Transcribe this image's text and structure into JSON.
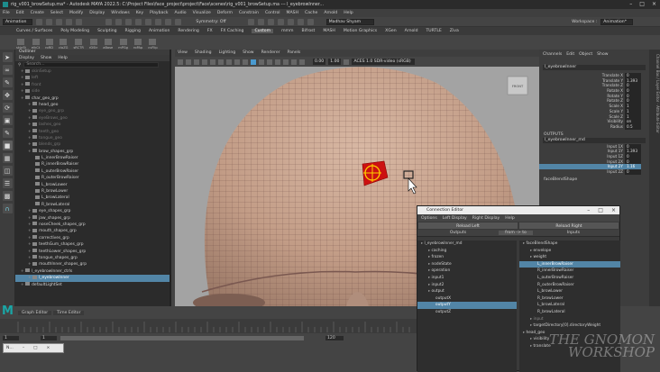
{
  "window": {
    "title": "rig_v001_browSetup.ma* - Autodesk MAYA 2022.5: C:\\Project Files\\face_project\\project\\Face\\scenes\\rig_v001_browSetup.ma  ---  l_eyebrowInner..."
  },
  "menubar": [
    "File",
    "Edit",
    "Create",
    "Select",
    "Modify",
    "Display",
    "Windows",
    "Key",
    "Playback",
    "Audio",
    "Visualize",
    "Deform",
    "Constrain",
    "Control",
    "MASH",
    "Cache",
    "Arnold",
    "Help"
  ],
  "menubar_right": [
    "ZBrush",
    "Cache",
    "AdvSkin",
    "FX",
    "Zeo Tools",
    "Ziva Transfer",
    "Arnold",
    "Help"
  ],
  "statusline": {
    "mode": "Animation",
    "symmetry": "Symmetry: Off",
    "user": "Madhav Shyam",
    "workspace_label": "Workspace :",
    "workspace": "Animation*"
  },
  "shelf_tabs": [
    "Curves / Surfaces",
    "Poly Modeling",
    "Sculpting",
    "Rigging",
    "Animation",
    "Rendering",
    "FX",
    "FX Caching",
    "Custom",
    "mmm",
    "Bifrost",
    "MASH",
    "Motion Graphics",
    "XGen",
    "Arnold",
    "TURTLE",
    "Ziva"
  ],
  "shelf_active": "Custom",
  "shelf_buttons": [
    "skinSt",
    "elkCt",
    "roRD",
    "cloZG",
    "sRCTR",
    "rDStr",
    "aBase",
    "mPGg",
    "roPAp",
    "cvFlip"
  ],
  "outliner": {
    "title": "Outliner",
    "menu": [
      "Display",
      "Show",
      "Help"
    ],
    "search_placeholder": "Search...",
    "rows": [
      {
        "label": "skinSetup",
        "indent": 0,
        "dim": true
      },
      {
        "label": "left",
        "indent": 0,
        "dim": true
      },
      {
        "label": "front",
        "indent": 0,
        "dim": true
      },
      {
        "label": "side",
        "indent": 0,
        "dim": true
      },
      {
        "label": "char_geo_grp",
        "indent": 0,
        "dim": false
      },
      {
        "label": "head_geo",
        "indent": 1,
        "dim": false
      },
      {
        "label": "eye_geo_grp",
        "indent": 1,
        "dim": true
      },
      {
        "label": "eyeBrows_geo",
        "indent": 1,
        "dim": true
      },
      {
        "label": "lashes_geo",
        "indent": 1,
        "dim": true
      },
      {
        "label": "teeth_geo",
        "indent": 1,
        "dim": true
      },
      {
        "label": "tongue_geo",
        "indent": 1,
        "dim": true
      },
      {
        "label": "blends_grp",
        "indent": 1,
        "dim": true
      },
      {
        "label": "brow_shapes_grp",
        "indent": 1,
        "dim": false
      },
      {
        "label": "L_innerBrowRaiser",
        "indent": 2,
        "dim": false
      },
      {
        "label": "R_innerBrowRaiser",
        "indent": 2,
        "dim": false
      },
      {
        "label": "L_outerBrowRaiser",
        "indent": 2,
        "dim": false
      },
      {
        "label": "R_outerBrowRaiser",
        "indent": 2,
        "dim": false
      },
      {
        "label": "L_browLower",
        "indent": 2,
        "dim": false
      },
      {
        "label": "R_browLower",
        "indent": 2,
        "dim": false
      },
      {
        "label": "L_browLateral",
        "indent": 2,
        "dim": false
      },
      {
        "label": "R_browLateral",
        "indent": 2,
        "dim": false
      },
      {
        "label": "eye_shapes_grp",
        "indent": 1,
        "dim": false
      },
      {
        "label": "jaw_shapes_grp",
        "indent": 1,
        "dim": false
      },
      {
        "label": "noseCheek_shapes_grp",
        "indent": 1,
        "dim": false
      },
      {
        "label": "mouth_shapes_grp",
        "indent": 1,
        "dim": false
      },
      {
        "label": "correctives_grp",
        "indent": 1,
        "dim": false
      },
      {
        "label": "teethGum_shapes_grp",
        "indent": 1,
        "dim": false
      },
      {
        "label": "teethLower_shapes_grp",
        "indent": 1,
        "dim": false
      },
      {
        "label": "tongue_shapes_grp",
        "indent": 1,
        "dim": false
      },
      {
        "label": "mouthInner_shapes_grp",
        "indent": 1,
        "dim": false
      },
      {
        "label": "l_eyebrowInner_ctrls",
        "indent": 0,
        "dim": false
      },
      {
        "label": "l_eyebrowInner",
        "indent": 1,
        "dim": false,
        "selected": true
      },
      {
        "label": "defaultLightSet",
        "indent": 0,
        "dim": false
      }
    ]
  },
  "viewport": {
    "menu": [
      "View",
      "Shading",
      "Lighting",
      "Show",
      "Renderer",
      "Panels"
    ],
    "near_clip": "0.00",
    "far_clip": "1.00",
    "colorspace": "ACES 1.0 SDR-video (sRGB)",
    "camera_label": "FRONT"
  },
  "channel_box": {
    "tabs": [
      "Channels",
      "Edit",
      "Object",
      "Show"
    ],
    "object": "l_eyebrowInner",
    "attrs": [
      {
        "name": "Translate X",
        "value": "0"
      },
      {
        "name": "Translate Y",
        "value": "1.393"
      },
      {
        "name": "Translate Z",
        "value": "0"
      },
      {
        "name": "Rotate X",
        "value": "0"
      },
      {
        "name": "Rotate Y",
        "value": "0"
      },
      {
        "name": "Rotate Z",
        "value": "0"
      },
      {
        "name": "Scale X",
        "value": "1"
      },
      {
        "name": "Scale Y",
        "value": "1"
      },
      {
        "name": "Scale Z",
        "value": "1"
      },
      {
        "name": "Visibility",
        "value": "on"
      },
      {
        "name": "Radius",
        "value": "0.5"
      }
    ],
    "outputs_label": "OUTPUTS",
    "output_node": "l_eyebrowInner_md",
    "outputs": [
      {
        "name": "Input 1X",
        "value": "0"
      },
      {
        "name": "Input 1Y",
        "value": "1.393"
      },
      {
        "name": "Input 1Z",
        "value": "0"
      },
      {
        "name": "Input 2X",
        "value": "0"
      },
      {
        "name": "Input 2Y",
        "value": "1.16",
        "selected": true
      },
      {
        "name": "Input 2Z",
        "value": "0"
      }
    ],
    "extra": "faceBlendShape"
  },
  "connection_editor": {
    "title": "Connection Editor",
    "menu": [
      "Options",
      "Left Display",
      "Right Display",
      "Help"
    ],
    "reload_left": "Reload Left",
    "reload_right": "Reload Right",
    "outputs_label": "Outputs",
    "direction": "from -> to",
    "inputs_label": "Inputs",
    "left_rows": [
      {
        "label": "l_eyebrowInner_md",
        "indent": 0
      },
      {
        "label": "caching",
        "indent": 1
      },
      {
        "label": "frozen",
        "indent": 1
      },
      {
        "label": "nodeState",
        "indent": 1
      },
      {
        "label": "operation",
        "indent": 1
      },
      {
        "label": "input1",
        "indent": 1
      },
      {
        "label": "input2",
        "indent": 1
      },
      {
        "label": "output",
        "indent": 1
      },
      {
        "label": "outputX",
        "indent": 2
      },
      {
        "label": "outputY",
        "indent": 2,
        "selected": true
      },
      {
        "label": "outputZ",
        "indent": 2
      }
    ],
    "right_rows": [
      {
        "label": "faceBlendShape",
        "indent": 0
      },
      {
        "label": "envelope",
        "indent": 1
      },
      {
        "label": "weight",
        "indent": 1
      },
      {
        "label": "L_innerBrowRaiser",
        "indent": 2,
        "selected": true
      },
      {
        "label": "R_innerBrowRaiser",
        "indent": 2
      },
      {
        "label": "L_outerBrowRaiser",
        "indent": 2
      },
      {
        "label": "R_outerBrowRaiser",
        "indent": 2
      },
      {
        "label": "L_browLower",
        "indent": 2
      },
      {
        "label": "R_browLower",
        "indent": 2
      },
      {
        "label": "L_browLateral",
        "indent": 2
      },
      {
        "label": "R_browLateral",
        "indent": 2
      },
      {
        "label": "input",
        "indent": 1,
        "dim": true
      },
      {
        "label": "targetDirectory[0].directoryWeight",
        "indent": 1
      },
      {
        "label": "head_geo",
        "indent": 0
      },
      {
        "label": "visibility",
        "indent": 1
      },
      {
        "label": "translate",
        "indent": 1
      }
    ]
  },
  "timeline": {
    "tabs": [
      "Graph Editor",
      "Time Editor"
    ],
    "start": "1",
    "end": "120",
    "current": "120",
    "field_a": "1",
    "field_b": "1"
  },
  "taskbar_app": "N...",
  "watermark": {
    "line1": "THE GNOMON",
    "line2": "WORKSHOP"
  },
  "colors": {
    "selection": "#5285a6",
    "control": "#cc1111",
    "accent": "#4a9ad0"
  }
}
